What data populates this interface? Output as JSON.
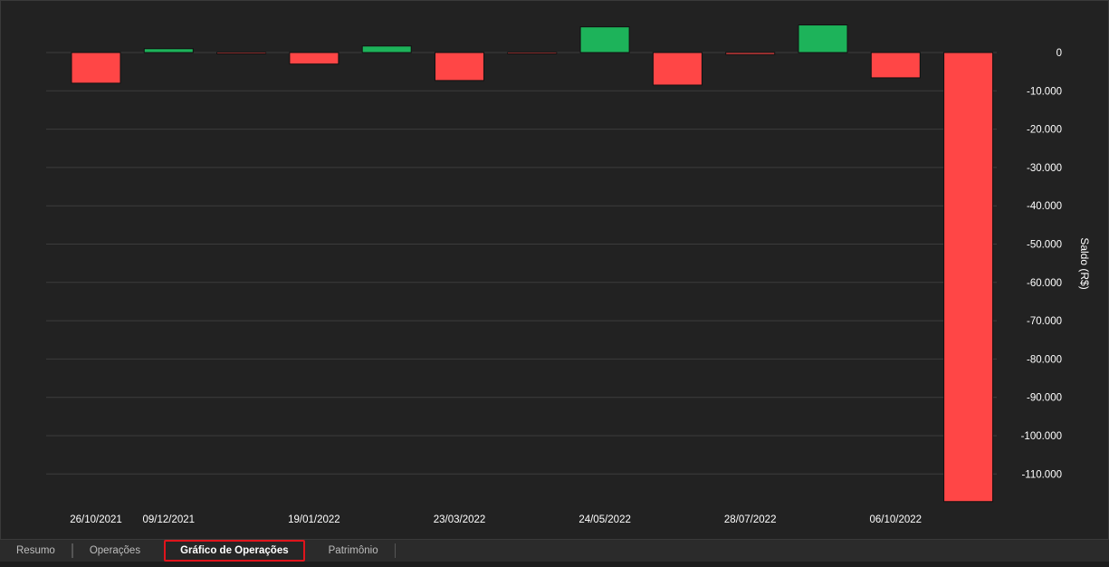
{
  "chart_data": {
    "type": "bar",
    "title": "",
    "ylabel": "Saldo (R$)",
    "xlabel": "",
    "ylim": [
      -117500,
      7500
    ],
    "yticks": [
      0,
      -10000,
      -20000,
      -30000,
      -40000,
      -50000,
      -60000,
      -70000,
      -80000,
      -90000,
      -100000,
      -110000
    ],
    "ytick_labels": [
      "0",
      "-10.000",
      "-20.000",
      "-30.000",
      "-40.000",
      "-50.000",
      "-60.000",
      "-70.000",
      "-80.000",
      "-90.000",
      "-100.000",
      "-110.000"
    ],
    "x_tick_labels": [
      "26/10/2021",
      "09/12/2021",
      "19/01/2022",
      "23/03/2022",
      "24/05/2022",
      "28/07/2022",
      "06/10/2022"
    ],
    "x_tick_bar_index": [
      0,
      1,
      3,
      5,
      7,
      9,
      11
    ],
    "values": [
      -8000,
      1000,
      -300,
      -3000,
      1700,
      -7300,
      -300,
      6700,
      -8500,
      -500,
      7200,
      -6600,
      -117200
    ],
    "grid": true,
    "colors": {
      "positive": "#1db35a",
      "negative": "#ff4646",
      "background": "#222222",
      "grid": "#3c3c3c",
      "text": "#ffffff"
    }
  },
  "tabs": [
    {
      "label": "Resumo",
      "active": false
    },
    {
      "label": "Operações",
      "active": false
    },
    {
      "label": "Gráfico de Operações",
      "active": true
    },
    {
      "label": "Patrimônio",
      "active": false
    }
  ]
}
